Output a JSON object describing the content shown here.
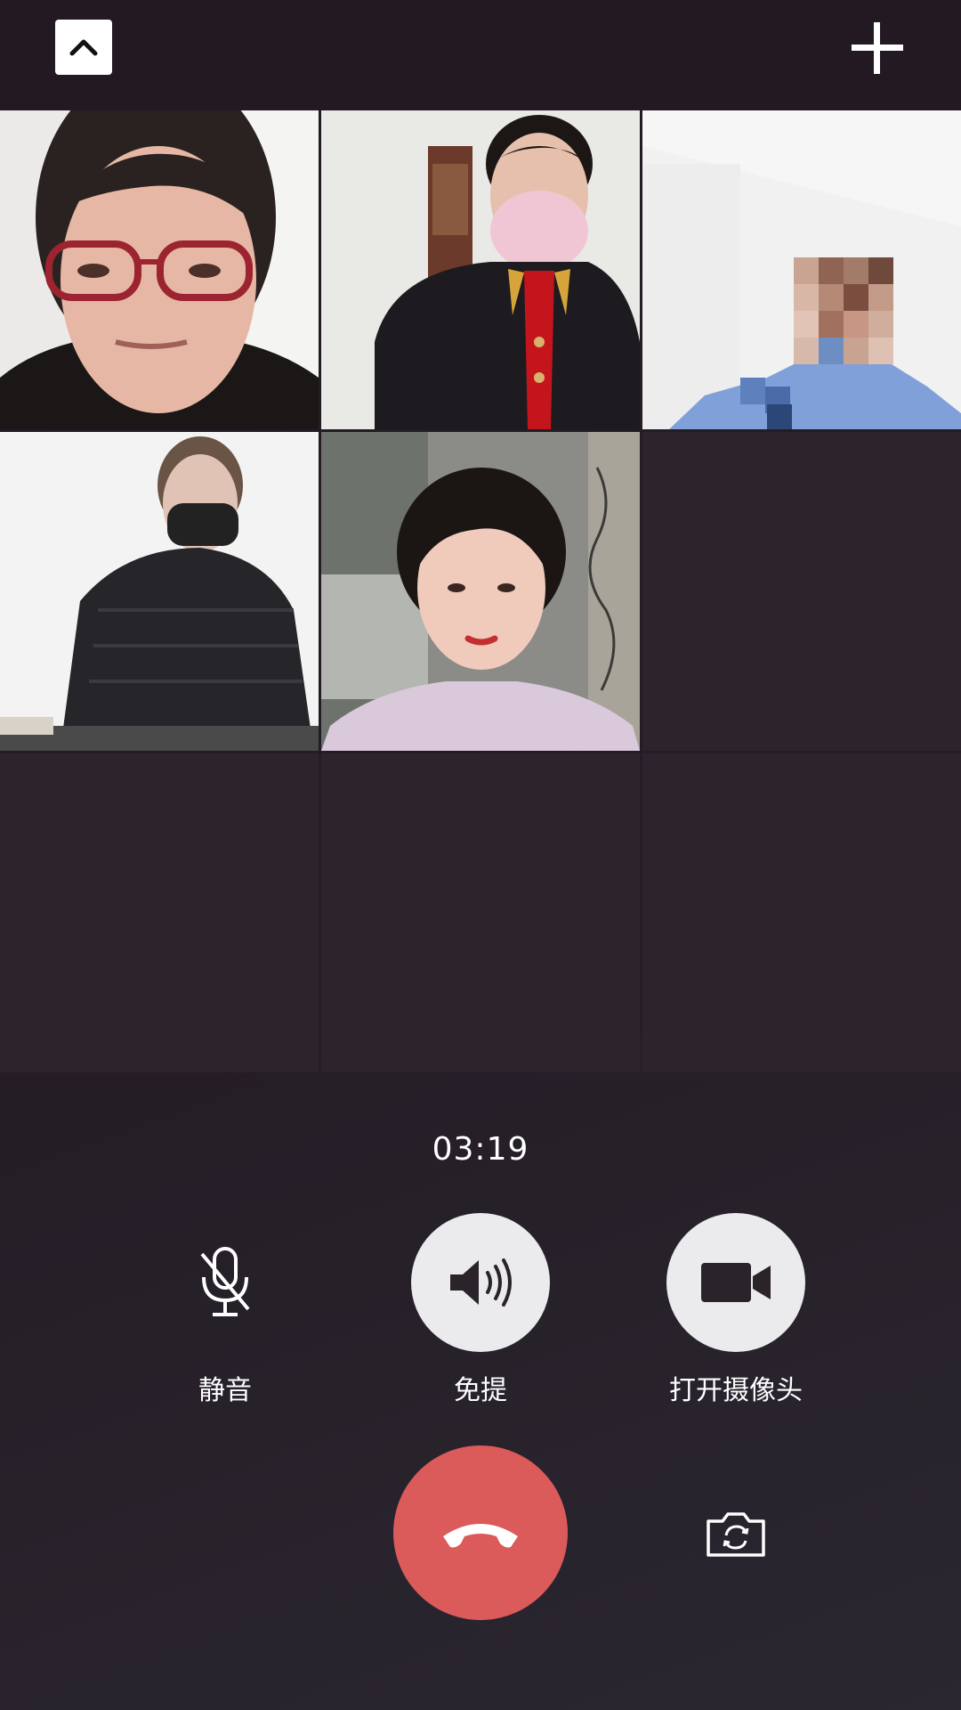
{
  "call": {
    "timer": "03:19"
  },
  "header": {
    "collapse_icon": "chevron-up-icon",
    "add_icon": "plus-icon"
  },
  "participants": [
    {
      "slot": 1,
      "state": "video-on"
    },
    {
      "slot": 2,
      "state": "video-on"
    },
    {
      "slot": 3,
      "state": "video-on"
    },
    {
      "slot": 4,
      "state": "video-on"
    },
    {
      "slot": 5,
      "state": "video-on"
    },
    {
      "slot": 6,
      "state": "empty"
    },
    {
      "slot": 7,
      "state": "empty"
    },
    {
      "slot": 8,
      "state": "empty"
    },
    {
      "slot": 9,
      "state": "empty"
    }
  ],
  "controls": {
    "mute": {
      "label": "静音",
      "icon": "microphone-off-icon"
    },
    "speaker": {
      "label": "免提",
      "icon": "speaker-icon"
    },
    "camera": {
      "label": "打开摄像头",
      "icon": "video-camera-icon"
    },
    "hangup": {
      "icon": "hang-up-icon"
    },
    "flip_camera": {
      "icon": "switch-camera-icon"
    }
  },
  "colors": {
    "background": "#231a23",
    "hangup": "#db5a5a",
    "control_circle": "#ebebee",
    "text": "#ffffff"
  }
}
